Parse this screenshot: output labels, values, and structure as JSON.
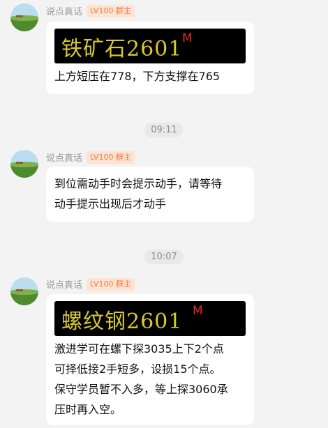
{
  "messages": [
    {
      "sender": "说点真话",
      "badge": "LV100 群主",
      "image": {
        "name": "铁矿石2601",
        "tag": "M"
      },
      "text": "上方短压在778，下方支撑在765"
    },
    {
      "sender": "说点真话",
      "badge": "LV100 群主",
      "text": "到位需动手时会提示动手，请等待\n动手提示出现后才动手"
    },
    {
      "sender": "说点真话",
      "badge": "LV100 群主",
      "image": {
        "name": "螺纹钢2601",
        "tag": "M"
      },
      "text": "激进学可在螺下探3035上下2个点\n可择低接2手短多，设损15个点。\n保守学员暂不入多，等上探3060承\n压时再入空。"
    }
  ],
  "timestamps": [
    "09:11",
    "10:07"
  ]
}
